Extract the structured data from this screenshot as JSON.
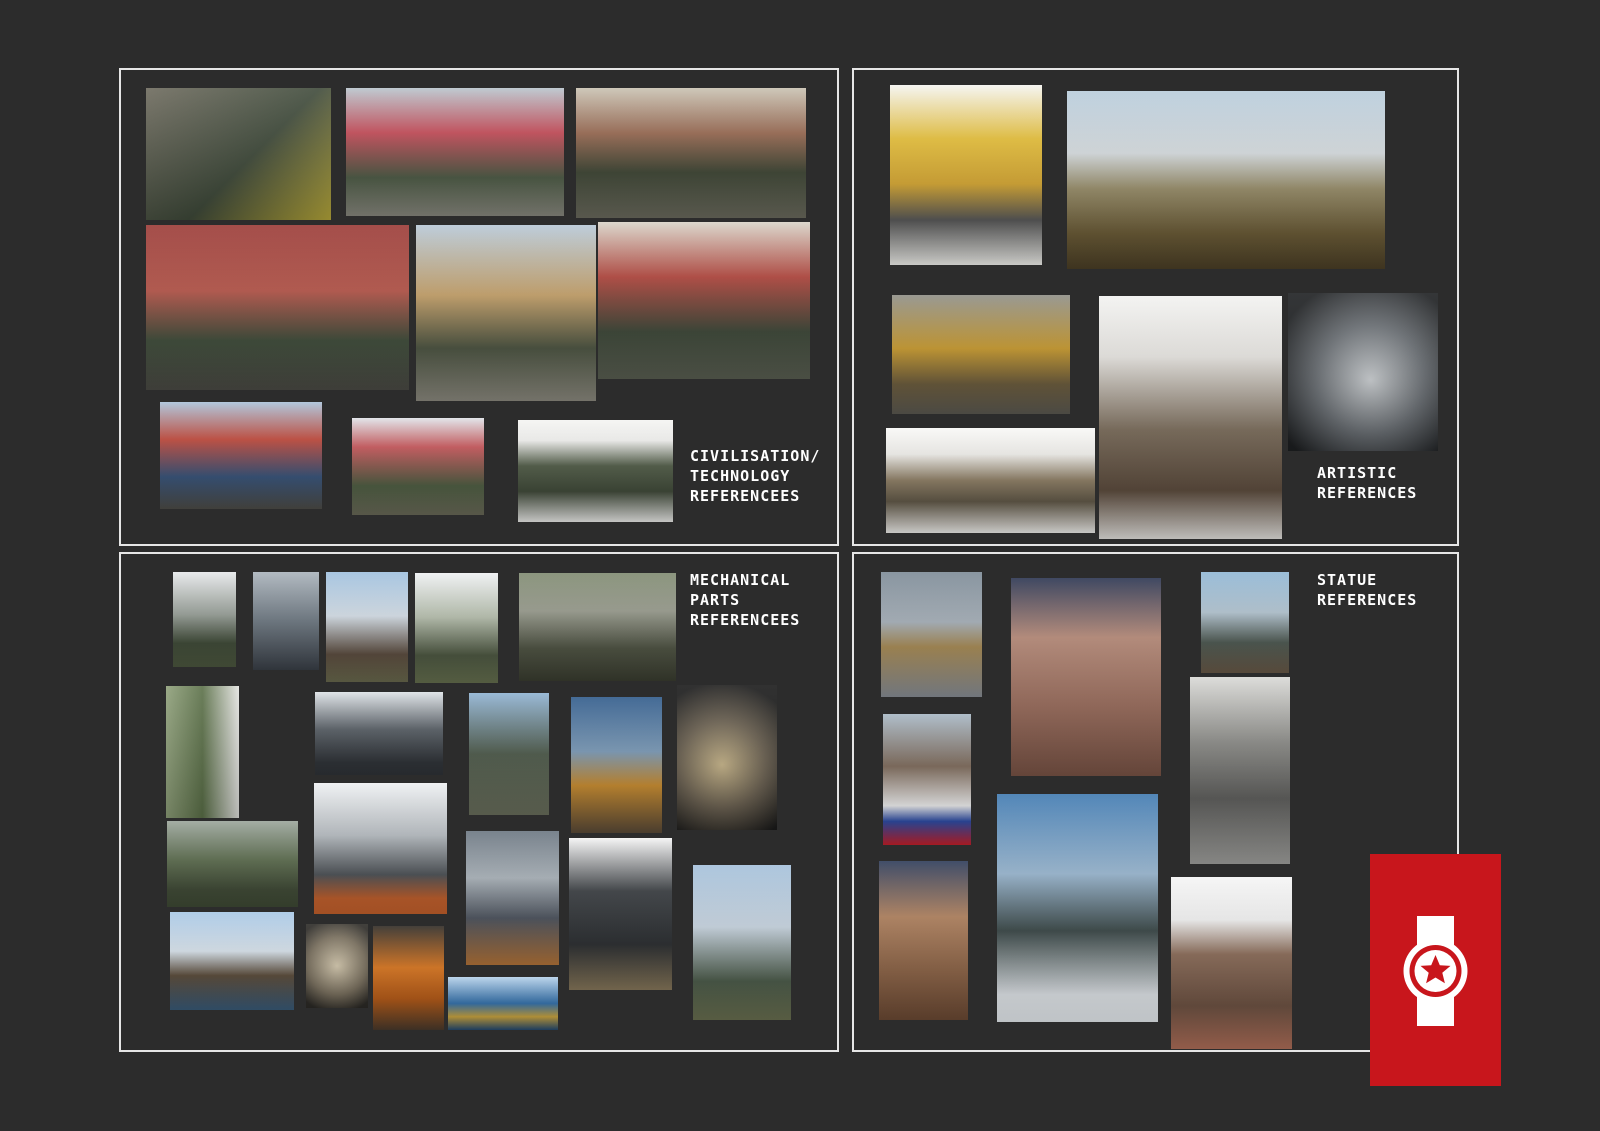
{
  "sections": {
    "civilisation": {
      "label": "CIVILISATION/\nTECHNOLOGY\nREFERENCEES"
    },
    "artistic": {
      "label": "ARTISTIC\nREFERENCES"
    },
    "mechanical": {
      "label": "MECHANICAL\nPARTS\nREFERENCEES"
    },
    "statue": {
      "label": "STATUE\nREFERENCES"
    }
  },
  "colors": {
    "background": "#2c2c2c",
    "border": "#e6e6e6",
    "label": "#ffffff",
    "logo_red": "#c8161c"
  },
  "logo": {
    "icon": "red-star-emblem-icon"
  }
}
